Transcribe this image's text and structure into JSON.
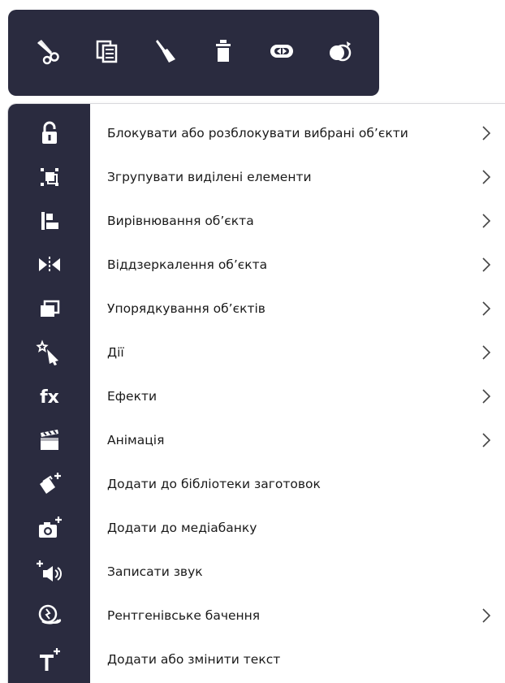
{
  "colors": {
    "panel_bg": "#2a2b3f",
    "icon_fg": "#ffffff",
    "menu_bg": "#ffffff",
    "text": "#1a1a1a",
    "arrow": "#444444"
  },
  "toolbar": {
    "buttons": [
      {
        "icon": "scissors-icon"
      },
      {
        "icon": "copy-icon"
      },
      {
        "icon": "brush-icon"
      },
      {
        "icon": "trash-icon"
      },
      {
        "icon": "link-icon"
      },
      {
        "icon": "clone-icon"
      }
    ]
  },
  "menu": {
    "items": [
      {
        "icon": "lock-icon",
        "label": "Блокувати або розблокувати вибрані об’єкти",
        "has_submenu": true
      },
      {
        "icon": "group-icon",
        "label": "Згрупувати виділені елементи",
        "has_submenu": true
      },
      {
        "icon": "align-icon",
        "label": "Вирівнювання об’єкта",
        "has_submenu": true
      },
      {
        "icon": "mirror-icon",
        "label": "Віддзеркалення об’єкта",
        "has_submenu": true
      },
      {
        "icon": "arrange-icon",
        "label": "Упорядкування об’єктів",
        "has_submenu": true
      },
      {
        "icon": "magic-cursor-icon",
        "label": "Дії",
        "has_submenu": true
      },
      {
        "icon": "fx-icon",
        "label": "Ефекти",
        "has_submenu": true
      },
      {
        "icon": "clapperboard-icon",
        "label": "Анімація",
        "has_submenu": true
      },
      {
        "icon": "add-to-library-icon",
        "label": "Додати до бібліотеки заготовок",
        "has_submenu": false
      },
      {
        "icon": "camera-add-icon",
        "label": "Додати до медіабанку",
        "has_submenu": false
      },
      {
        "icon": "record-sound-icon",
        "label": "Записати звук",
        "has_submenu": false
      },
      {
        "icon": "xray-icon",
        "label": "Рентгенівське бачення",
        "has_submenu": true
      },
      {
        "icon": "add-text-icon",
        "label": "Додати або змінити текст",
        "has_submenu": false
      }
    ]
  }
}
